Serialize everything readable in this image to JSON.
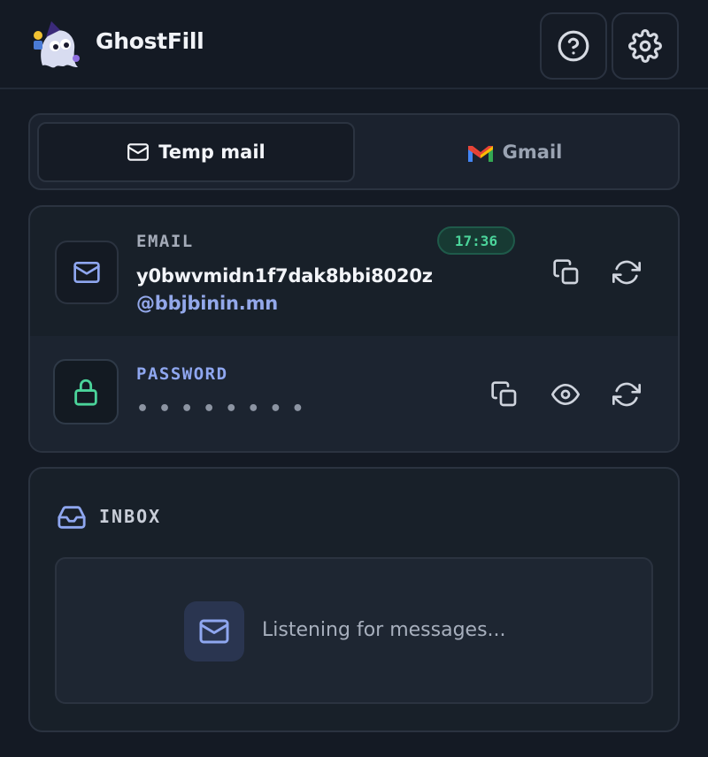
{
  "app": {
    "title": "GhostFill"
  },
  "header": {
    "help_icon": "help-circle-icon",
    "settings_icon": "gear-icon"
  },
  "tabs": [
    {
      "label": "Temp mail",
      "icon": "mail-icon",
      "active": true
    },
    {
      "label": "Gmail",
      "icon": "gmail-icon",
      "active": false
    }
  ],
  "email": {
    "label": "EMAIL",
    "timer": "17:36",
    "address_local": "y0bwvmidn1f7dak8bbi8020z",
    "address_domain": "@bbjbinin.mn"
  },
  "password": {
    "label": "PASSWORD",
    "masked": "••••••••"
  },
  "inbox": {
    "title": "INBOX",
    "empty_text": "Listening for messages..."
  },
  "colors": {
    "background": "#141a24",
    "accent": "#93a8ea",
    "timer_green": "#4bd49a",
    "lock_green": "#4bd49a"
  }
}
